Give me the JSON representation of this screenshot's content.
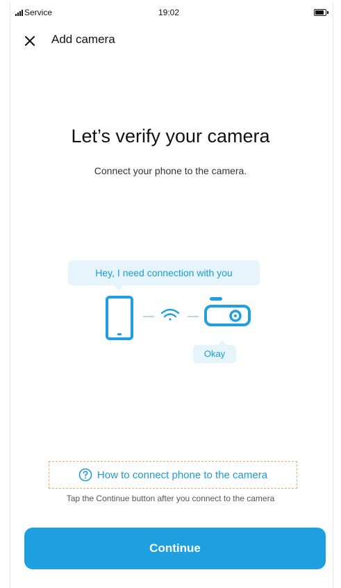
{
  "status_bar": {
    "carrier": "Service",
    "time": "19:02"
  },
  "header": {
    "title": "Add camera",
    "close_icon": "close-icon"
  },
  "main": {
    "title": "Let’s verify your camera",
    "subtitle": "Connect your phone to the camera."
  },
  "illustration": {
    "phone_bubble": "Hey, I need connection with you",
    "camera_bubble": "Okay",
    "icons": [
      "phone-icon",
      "wifi-icon",
      "camera-icon"
    ]
  },
  "help": {
    "link_label": "How to connect phone to the camera",
    "icon": "question-circle-icon",
    "hint": "Tap the Continue button after you connect to the camera"
  },
  "actions": {
    "continue_label": "Continue"
  },
  "colors": {
    "accent": "#1e9fe0",
    "bubble_bg": "#e6f4fb",
    "help_border": "#f0a468"
  }
}
